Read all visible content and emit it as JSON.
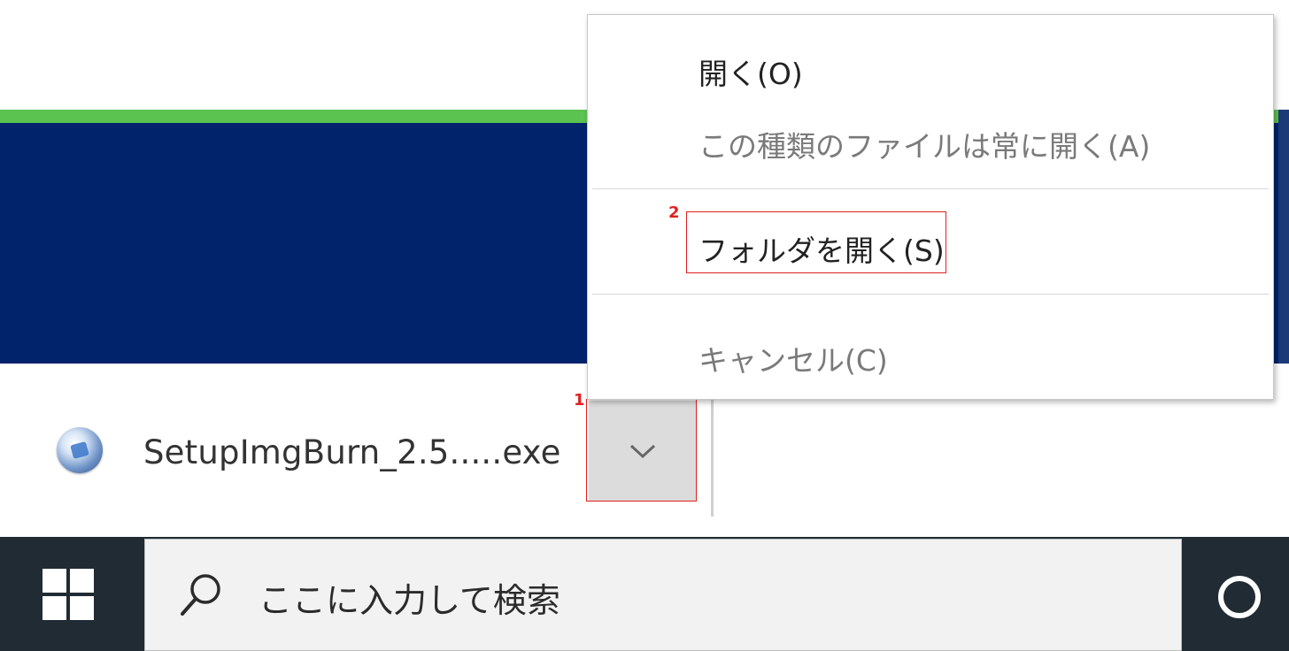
{
  "download_bar": {
    "file_name": "SetupImgBurn_2.5.....exe"
  },
  "annotations": {
    "step1": "1",
    "step2": "2"
  },
  "context_menu": {
    "items": [
      {
        "label": "開く(O)",
        "enabled": true
      },
      {
        "label": "この種類のファイルは常に開く(A)",
        "enabled": false
      },
      {
        "label": "フォルダを開く(S)",
        "enabled": true
      },
      {
        "label": "キャンセル(C)",
        "enabled": false
      }
    ]
  },
  "taskbar": {
    "search_placeholder": "ここに入力して検索"
  },
  "colors": {
    "header_green": "#5bc34f",
    "header_navy": "#00236b",
    "annotation_red": "#e02020",
    "taskbar": "#202b33"
  },
  "icons": [
    "setup-file-icon",
    "chevron-down-icon",
    "windows-logo-icon",
    "search-icon",
    "cortana-icon"
  ]
}
